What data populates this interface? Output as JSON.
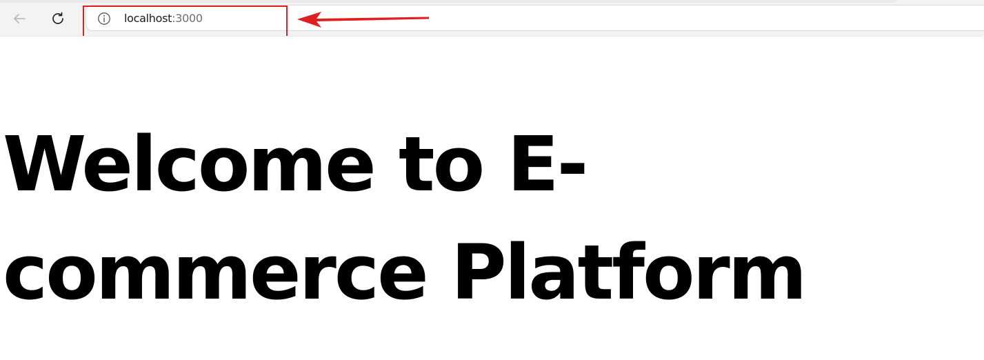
{
  "browser": {
    "address_bar": {
      "host": "localhost",
      "port": ":3000"
    },
    "icons": {
      "back": "back-arrow-icon",
      "reload": "reload-icon",
      "site_info": "info-icon"
    }
  },
  "annotation": {
    "highlight_color": "#e02020",
    "arrow_color": "#e02020"
  },
  "page": {
    "heading": "Welcome to E-commerce Platform"
  }
}
